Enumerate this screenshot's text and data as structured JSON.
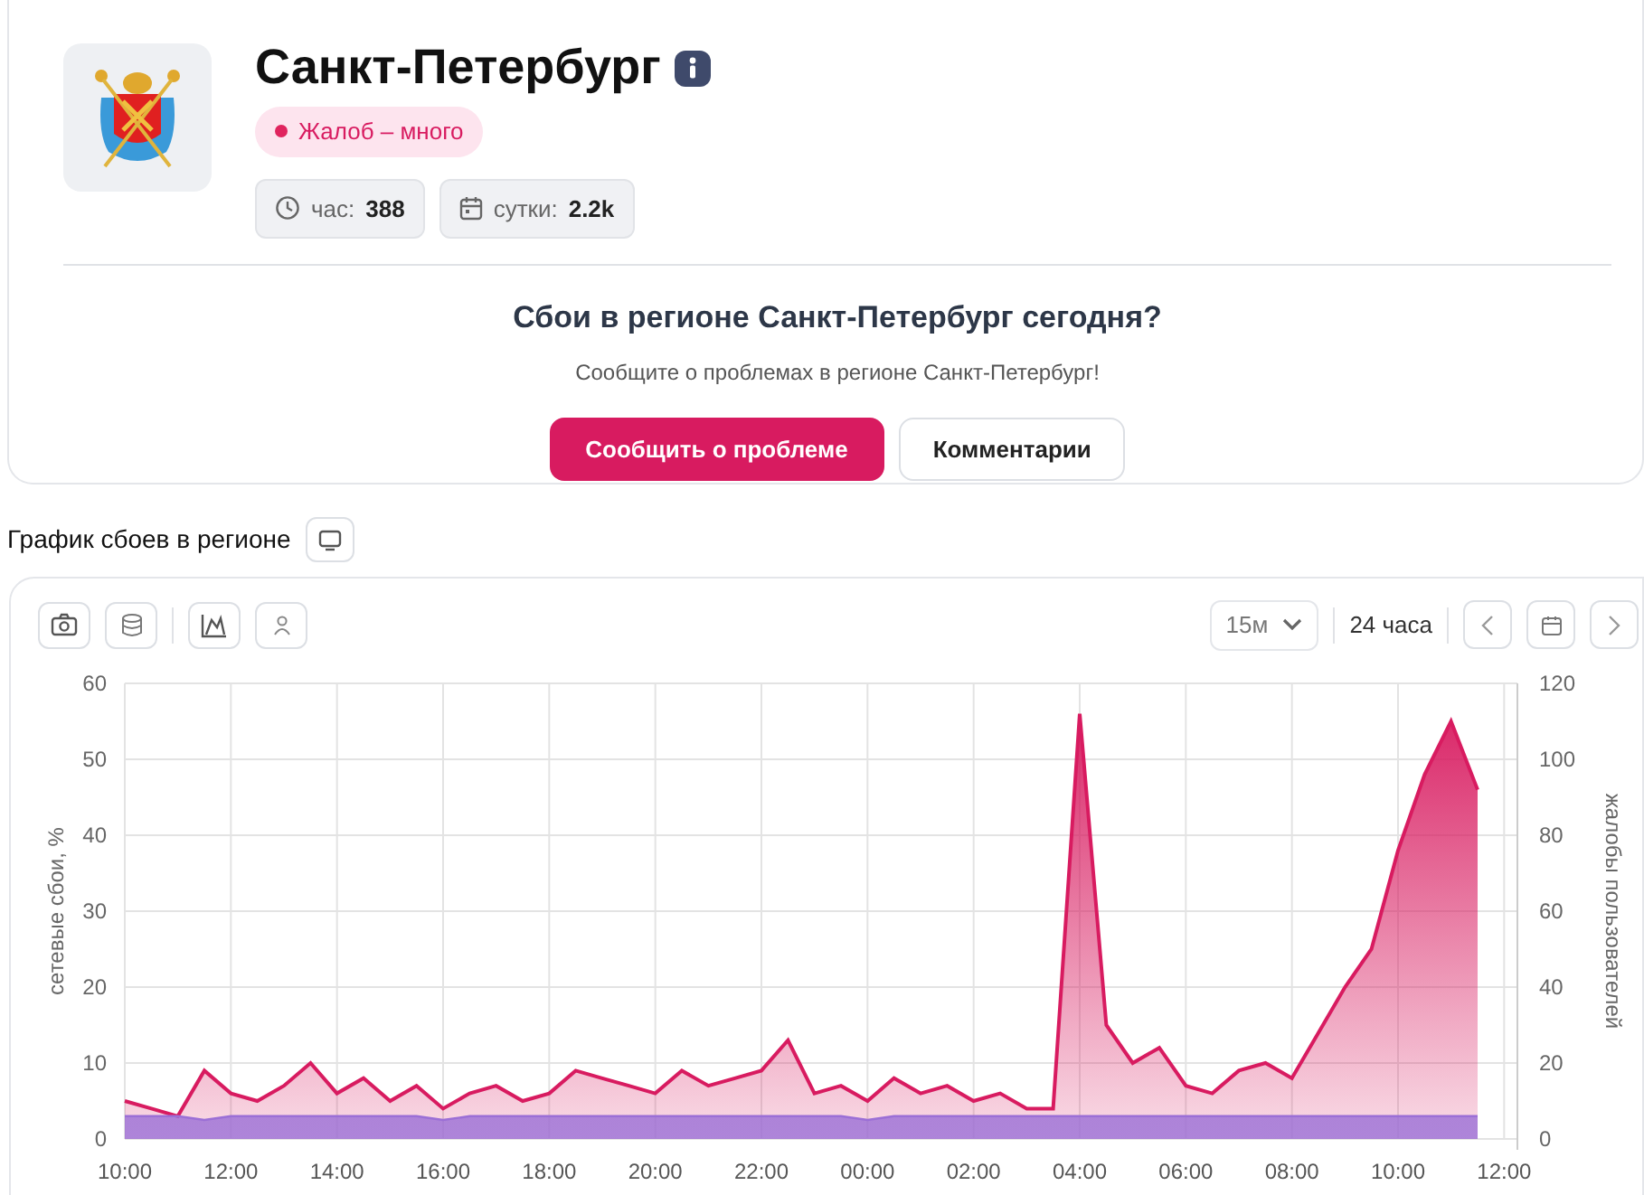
{
  "region": {
    "name": "Санкт-Петербург",
    "status": "Жалоб – много",
    "stats": [
      {
        "kind": "hour",
        "label": "час:",
        "value": "388"
      },
      {
        "kind": "day",
        "label": "сутки:",
        "value": "2.2k"
      }
    ]
  },
  "report": {
    "title": "Сбои в регионе Санкт-Петербург сегодня?",
    "text": "Сообщите о проблемах в регионе Санкт-Петербург!",
    "buttons": [
      {
        "label": "Сообщить о проблеме",
        "kind": "primary"
      },
      {
        "label": "Комментарии",
        "kind": "outline"
      }
    ]
  },
  "chart_section": {
    "title": "График сбоев в регионе",
    "interval": "15м",
    "range": "24 часа",
    "chart_data": {
      "type": "area",
      "ylabel": "сетевые сбои, %",
      "y2label": "жалобы пользователей",
      "ylim": [
        0,
        60
      ],
      "y2lim": [
        0,
        120
      ],
      "grid": true,
      "categories": [
        "10:00",
        null,
        null,
        null,
        "12:00",
        null,
        null,
        null,
        "14:00",
        null,
        null,
        null,
        "16:00",
        null,
        null,
        null,
        "18:00",
        null,
        null,
        null,
        "20:00",
        null,
        null,
        null,
        "22:00",
        null,
        null,
        null,
        "00:00",
        null,
        null,
        null,
        "02:00",
        null,
        null,
        null,
        "04:00",
        null,
        null,
        null,
        "06:00",
        null,
        null,
        null,
        "08:00",
        null,
        null,
        null,
        "10:00",
        null,
        null,
        null,
        "12:00"
      ],
      "series": [
        {
          "color": "#9b6fd6",
          "values": [
            3,
            3,
            3,
            2.5,
            3,
            3,
            3,
            3,
            3,
            3,
            3,
            3,
            2.5,
            3,
            3,
            3,
            3,
            3,
            3,
            3,
            3,
            3,
            3,
            3,
            3,
            3,
            3,
            3,
            2.5,
            3,
            3,
            3,
            3,
            3,
            3,
            3,
            3,
            3,
            3,
            3,
            3,
            3,
            3,
            3,
            3,
            3,
            3,
            3,
            3,
            3,
            3,
            3,
            null
          ]
        },
        {
          "color": "#d81b60",
          "values": [
            5,
            4,
            3,
            9,
            6,
            5,
            7,
            10,
            6,
            8,
            5,
            7,
            4,
            6,
            7,
            5,
            6,
            9,
            8,
            7,
            6,
            9,
            7,
            8,
            9,
            13,
            6,
            7,
            5,
            8,
            6,
            7,
            5,
            6,
            4,
            4,
            56,
            15,
            10,
            12,
            7,
            6,
            9,
            10,
            8,
            14,
            20,
            25,
            38,
            48,
            55,
            46,
            null
          ]
        }
      ],
      "yticks": [
        0,
        10,
        20,
        30,
        40,
        50,
        60
      ],
      "y2ticks": [
        0,
        20,
        40,
        60,
        80,
        100,
        120
      ]
    }
  }
}
